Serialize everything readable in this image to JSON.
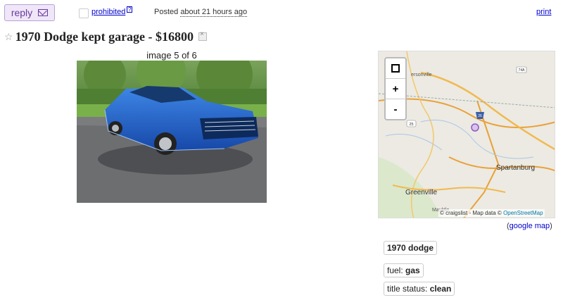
{
  "topbar": {
    "reply_label": "reply",
    "prohibited_label": "prohibited",
    "prohibited_help": "?",
    "posted_prefix": "Posted",
    "posted_time": "about 21 hours ago",
    "print_label": "print"
  },
  "posting": {
    "title": "1970 Dodge kept garage - $16800",
    "image_caption": "image 5 of 6"
  },
  "map": {
    "labels": [
      "ersonville",
      "Spartanburg",
      "Greenville",
      "Mauldin"
    ],
    "shields": [
      "74A",
      "26",
      "25"
    ],
    "attribution_prefix": "© craigslist - Map data ©",
    "attribution_link": "OpenStreetMap",
    "google_map_label": "google map",
    "zoom_in": "+",
    "zoom_out": "-"
  },
  "attributes": {
    "headline": "1970 dodge",
    "fuel_label": "fuel:",
    "fuel_value": "gas",
    "title_status_label": "title status:",
    "title_status_value": "clean"
  },
  "colors": {
    "reply_bg": "#efe6f8",
    "reply_border": "#b9a2d6",
    "link": "#0000cc",
    "car_blue": "#1f5fc4"
  }
}
